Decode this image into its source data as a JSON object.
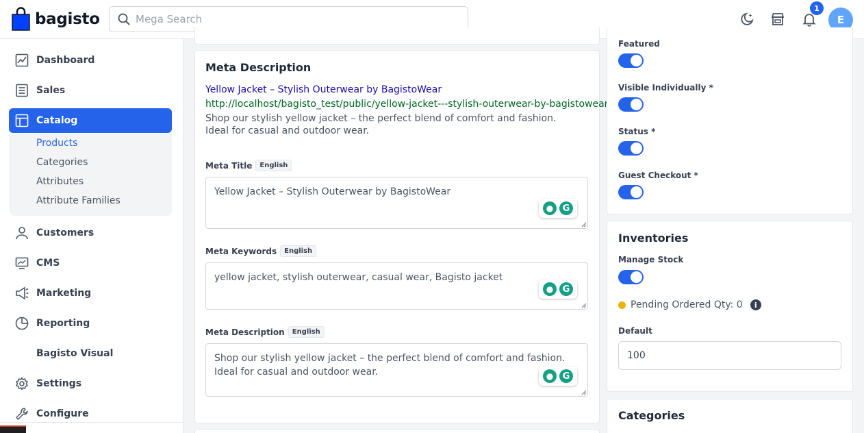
{
  "header": {
    "logo_text": "bagisto",
    "search_placeholder": "Mega Search",
    "notification_count": "1",
    "avatar_initial": "E"
  },
  "sidebar": {
    "items": [
      {
        "label": "Dashboard",
        "icon": "chart-icon"
      },
      {
        "label": "Sales",
        "icon": "receipt-icon"
      },
      {
        "label": "Catalog",
        "icon": "catalog-icon",
        "active": true
      },
      {
        "label": "Customers",
        "icon": "user-icon"
      },
      {
        "label": "CMS",
        "icon": "monitor-icon"
      },
      {
        "label": "Marketing",
        "icon": "megaphone-icon"
      },
      {
        "label": "Reporting",
        "icon": "pie-icon"
      },
      {
        "label": "Bagisto Visual",
        "icon": ""
      },
      {
        "label": "Settings",
        "icon": "gear-icon"
      },
      {
        "label": "Configure",
        "icon": "wrench-icon"
      }
    ],
    "catalog_submenu": [
      "Products",
      "Categories",
      "Attributes",
      "Attribute Families"
    ]
  },
  "meta": {
    "title": "Meta Description",
    "preview_title": "Yellow Jacket – Stylish Outerwear by BagistoWear",
    "preview_url": "http://localhost/bagisto_test/public/yellow-jacket---stylish-outerwear-by-bagistowear",
    "preview_desc": "Shop our stylish yellow jacket – the perfect blend of comfort and fashion. Ideal for casual and outdoor wear.",
    "lang": "English",
    "fields": {
      "meta_title_label": "Meta Title",
      "meta_title_value": "Yellow Jacket – Stylish Outerwear by BagistoWear",
      "meta_keywords_label": "Meta Keywords",
      "meta_keywords_value": "yellow jacket, stylish outerwear, casual wear, Bagisto jacket",
      "meta_desc_label": "Meta Description",
      "meta_desc_value": "Shop our stylish yellow jacket – the perfect blend of comfort and fashion. Ideal for casual and outdoor wear."
    }
  },
  "settings": {
    "featured": "Featured",
    "visible_individually": "Visible Individually *",
    "status": "Status *",
    "guest_checkout": "Guest Checkout *"
  },
  "inventories": {
    "title": "Inventories",
    "manage_stock": "Manage Stock",
    "pending_ordered": "Pending Ordered Qty: 0",
    "default_label": "Default",
    "default_value": "100"
  },
  "categories": {
    "title": "Categories"
  },
  "colors": {
    "accent": "#2563eb",
    "seo_link": "#1a0dab",
    "seo_url": "#006621",
    "grammarly": "#15a085"
  }
}
